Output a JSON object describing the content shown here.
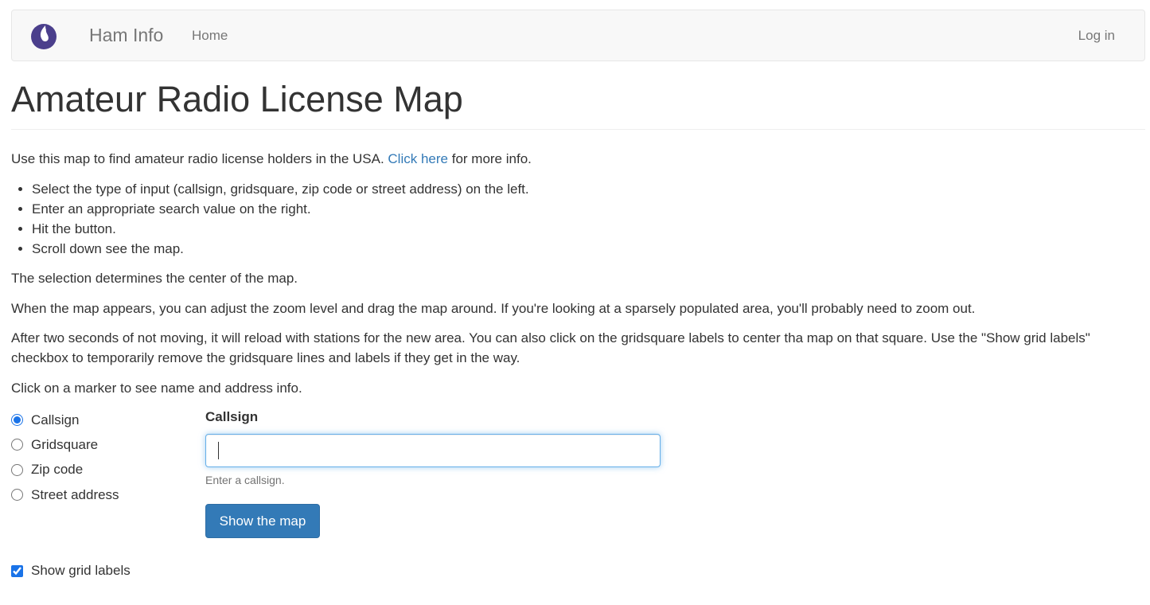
{
  "navbar": {
    "logo_icon": "drop-logo-icon",
    "brand": "Ham Info",
    "home_label": "Home",
    "login_label": "Log in"
  },
  "page": {
    "title": "Amateur Radio License Map",
    "intro_prefix": "Use this map to find amateur radio license holders in the USA. ",
    "intro_link": "Click here",
    "intro_suffix": " for more info.",
    "steps": [
      "Select the type of input (callsign, gridsquare, zip code or street address) on the left.",
      "Enter an appropriate search value on the right.",
      "Hit the button.",
      "Scroll down see the map."
    ],
    "selection_note": "The selection determines the center of the map.",
    "zoom_note": "When the map appears, you can adjust the zoom level and drag the map around. If you're looking at a sparsely populated area, you'll probably need to zoom out.",
    "reload_note": "After two seconds of not moving, it will reload with stations for the new area. You can also click on the gridsquare labels to center tha map on that square. Use the \"Show grid labels\" checkbox to temporarily remove the gridsquare lines and labels if they get in the way.",
    "marker_note": "Click on a marker to see name and address info."
  },
  "search": {
    "input_types": [
      {
        "label": "Callsign",
        "checked": true
      },
      {
        "label": "Gridsquare",
        "checked": false
      },
      {
        "label": "Zip code",
        "checked": false
      },
      {
        "label": "Street address",
        "checked": false
      }
    ],
    "field_label": "Callsign",
    "field_value": "",
    "help_text": "Enter a callsign.",
    "submit_label": "Show the map",
    "grid_labels_label": "Show grid labels",
    "grid_labels_checked": true
  },
  "colors": {
    "link": "#337ab7",
    "primary_button": "#337ab7",
    "focus_border": "#66afe9",
    "logo": "#4b3f8c"
  }
}
